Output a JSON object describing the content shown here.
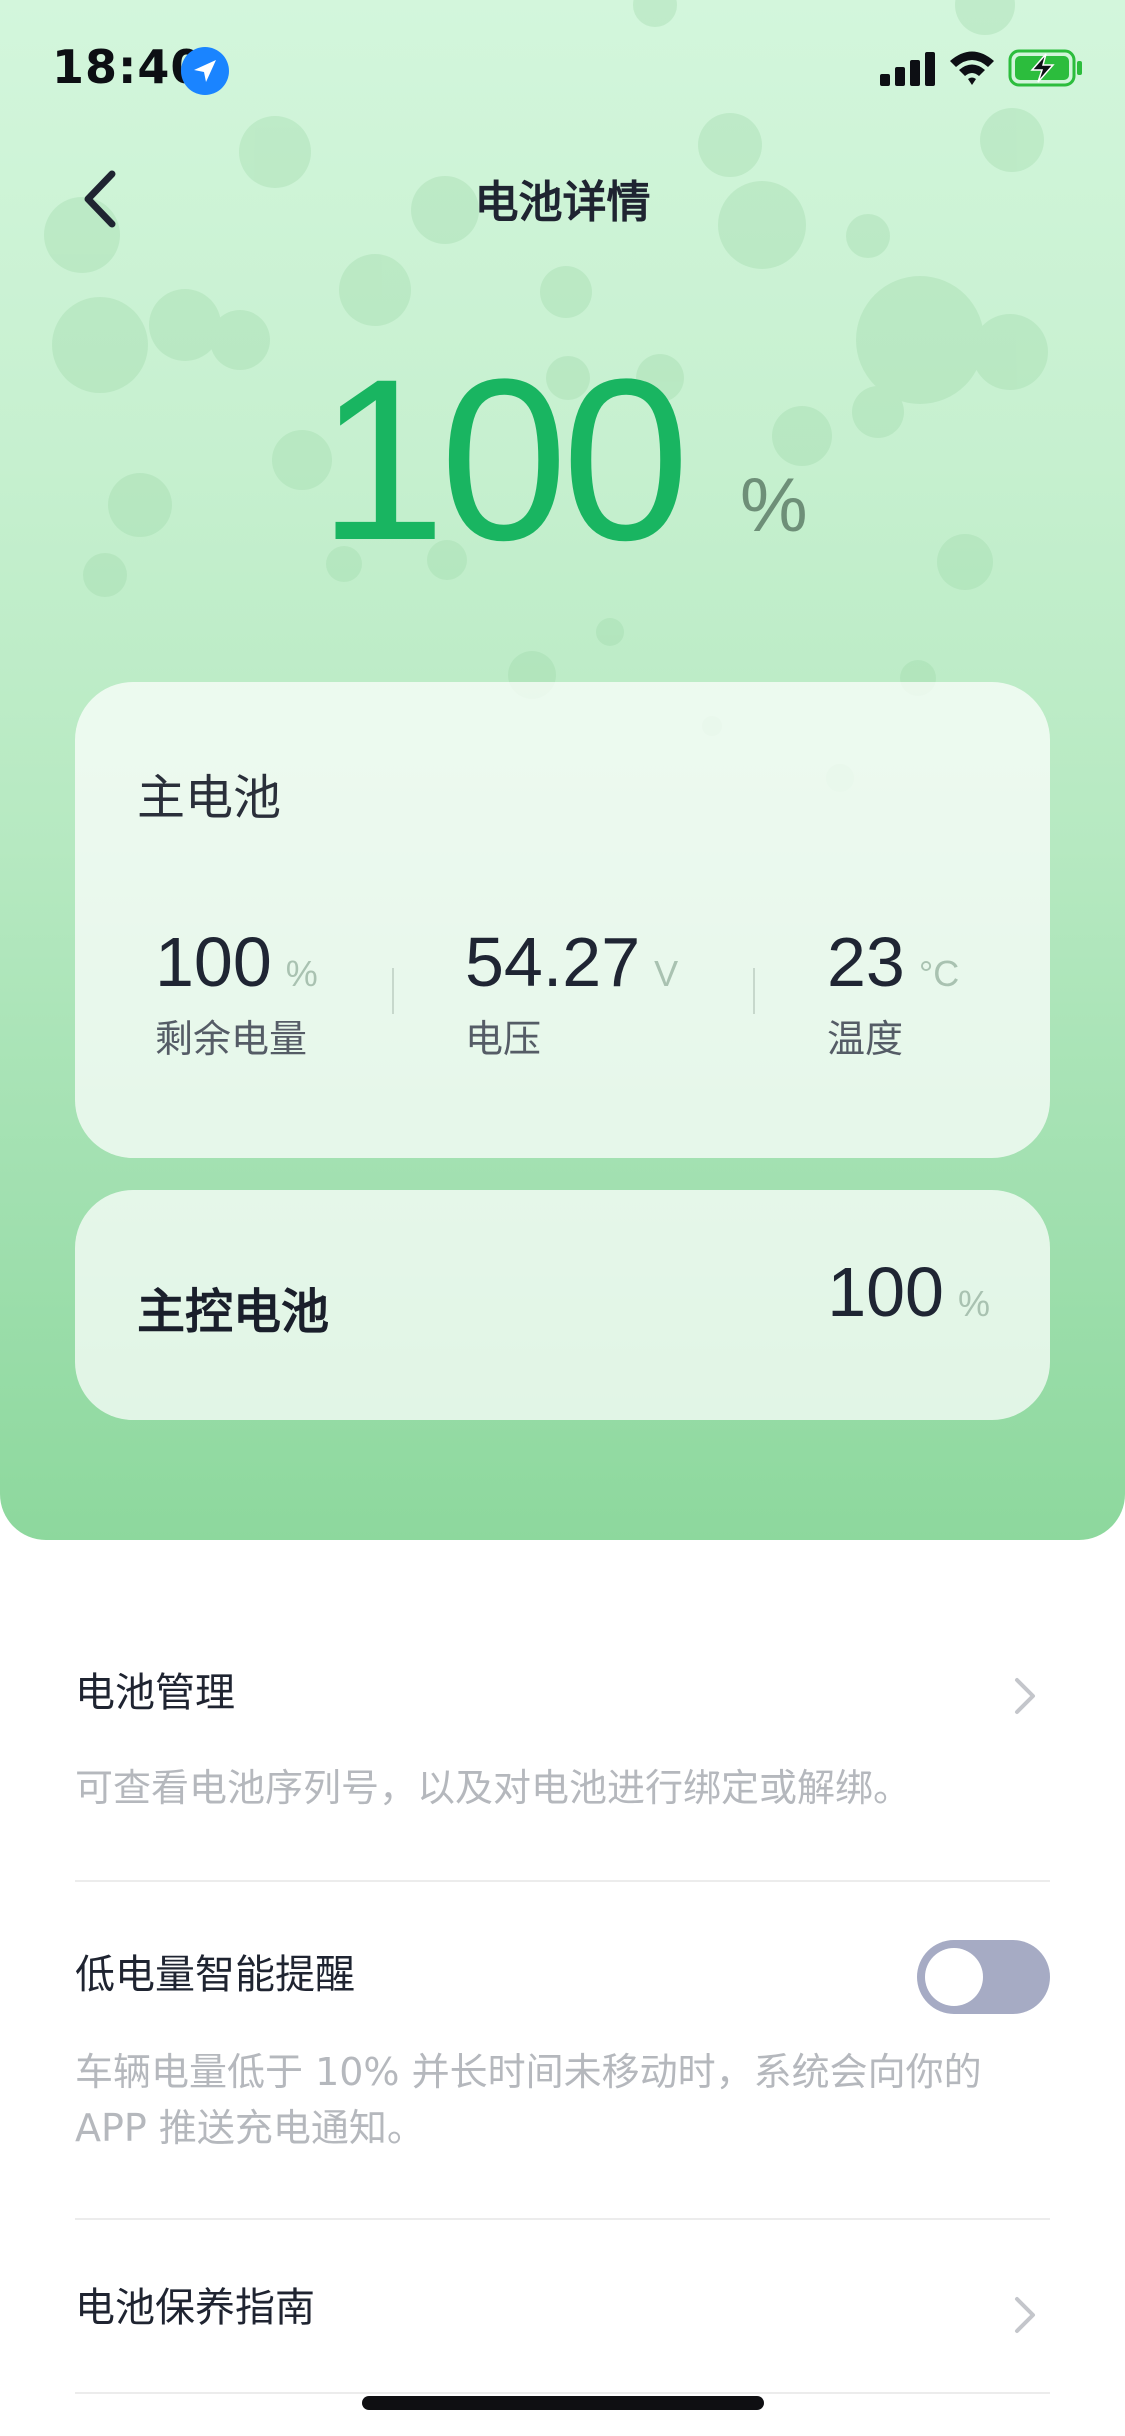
{
  "status_bar": {
    "time": "18:40",
    "icons": [
      "location-icon",
      "signal-icon",
      "wifi-icon",
      "battery-charging-icon"
    ]
  },
  "header": {
    "title": "电池详情",
    "back_icon": "chevron-left-icon"
  },
  "overall": {
    "value": "100",
    "unit": "%"
  },
  "main_battery": {
    "title": "主电池",
    "stats": [
      {
        "value": "100",
        "unit": "%",
        "label": "剩余电量"
      },
      {
        "value": "54.27",
        "unit": "V",
        "label": "电压"
      },
      {
        "value": "23",
        "unit": "°C",
        "label": "温度"
      }
    ]
  },
  "control_battery": {
    "title": "主控电池",
    "value": "100",
    "unit": "%"
  },
  "list": {
    "battery_management": {
      "title": "电池管理",
      "description": "可查看电池序列号，以及对电池进行绑定或解绑。"
    },
    "low_battery_alert": {
      "title": "低电量智能提醒",
      "description": "车辆电量低于 10% 并长时间未移动时，系统会向你的 APP 推送充电通知。",
      "enabled": false
    },
    "battery_guide": {
      "title": "电池保养指南"
    }
  },
  "colors": {
    "accent_green": "#19b561",
    "toggle_off": "#a6abc4"
  }
}
